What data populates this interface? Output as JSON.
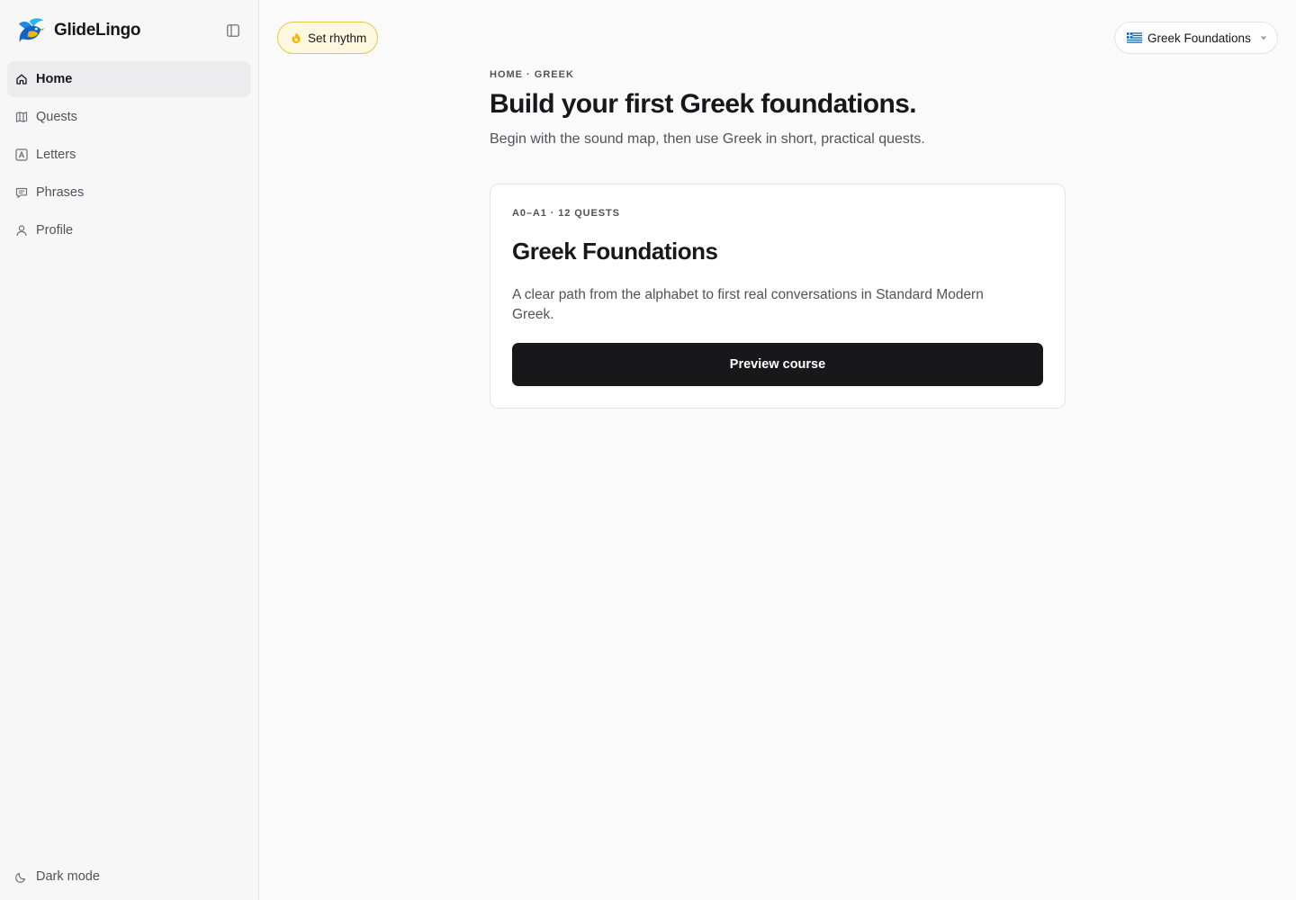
{
  "app": {
    "name": "GlideLingo"
  },
  "sidebar": {
    "items": [
      {
        "label": "Home",
        "icon": "home-icon",
        "active": true
      },
      {
        "label": "Quests",
        "icon": "map-icon",
        "active": false
      },
      {
        "label": "Letters",
        "icon": "letter-a-icon",
        "active": false
      },
      {
        "label": "Phrases",
        "icon": "chat-icon",
        "active": false
      },
      {
        "label": "Profile",
        "icon": "user-icon",
        "active": false
      }
    ],
    "dark_mode_label": "Dark mode"
  },
  "header": {
    "rhythm_label": "Set rhythm",
    "course_select": {
      "value": "Greek Foundations",
      "flag": "greece-flag-icon"
    }
  },
  "main": {
    "breadcrumb": "HOME · GREEK",
    "title": "Build your first Greek foundations.",
    "subtitle": "Begin with the sound map, then use Greek in short, practical quests."
  },
  "course_card": {
    "meta": "A0–A1 · 12 QUESTS",
    "title": "Greek Foundations",
    "description": "A clear path from the alphabet to first real conversations in Standard Modern Greek.",
    "button_label": "Preview course"
  },
  "colors": {
    "accent_yellow": "#e8c64a",
    "primary_button": "#18181b",
    "active_nav_bg": "#ececee",
    "logo_blue": "#1e88e5",
    "logo_yellow": "#f5b800"
  }
}
